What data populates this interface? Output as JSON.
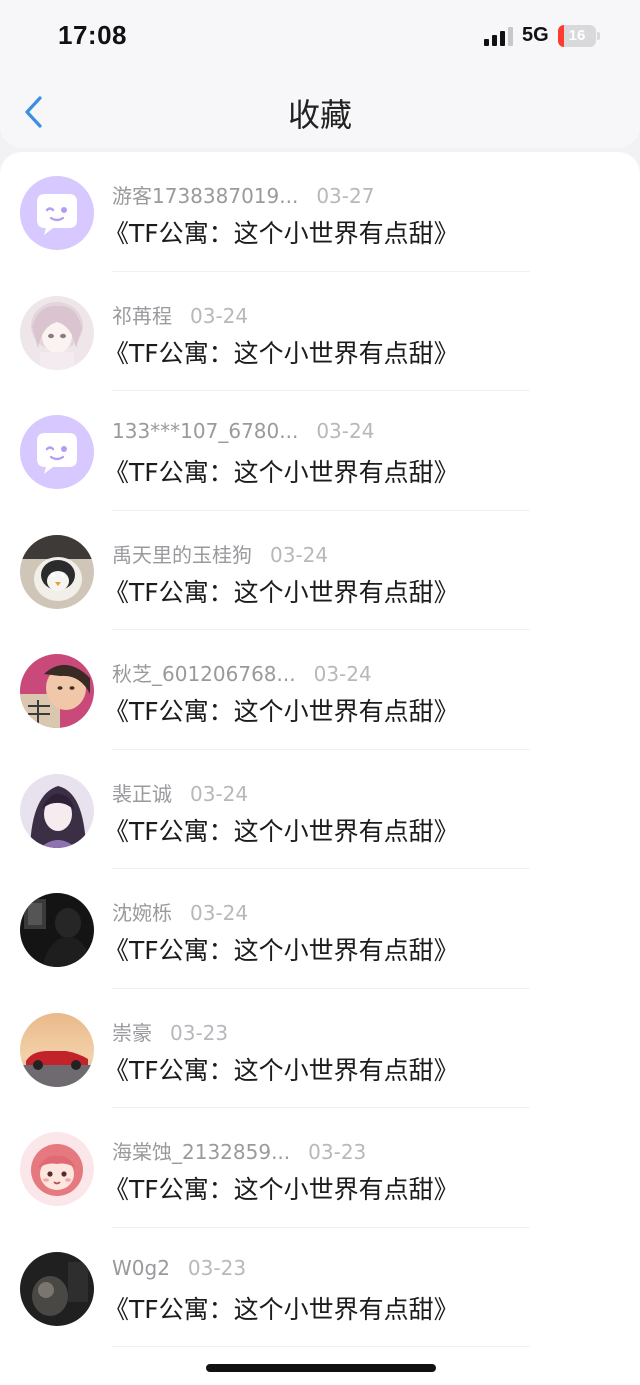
{
  "status_bar": {
    "time": "17:08",
    "network": "5G",
    "battery": {
      "level": "16",
      "fraction": 0.16,
      "color": "#ff3b30"
    }
  },
  "nav": {
    "back_icon": "chevron-left-icon",
    "title": "收藏",
    "accent": "#3a8ee6"
  },
  "favorites": [
    {
      "user": "游客1738387019...",
      "date": "03-27",
      "work": "《TF公寓：这个小世界有点甜》",
      "avatar": "default-chat-avatar"
    },
    {
      "user": "祁苒程",
      "date": "03-24",
      "work": "《TF公寓：这个小世界有点甜》",
      "avatar": "anime-girl-light"
    },
    {
      "user": "133***107_6780...",
      "date": "03-24",
      "work": "《TF公寓：这个小世界有点甜》",
      "avatar": "default-chat-avatar"
    },
    {
      "user": "禹天里的玉桂狗",
      "date": "03-24",
      "work": "《TF公寓：这个小世界有点甜》",
      "avatar": "penguin-plush"
    },
    {
      "user": "秋芝_601206768...",
      "date": "03-24",
      "work": "《TF公寓：这个小世界有点甜》",
      "avatar": "child-photo"
    },
    {
      "user": "裴正诚",
      "date": "03-24",
      "work": "《TF公寓：这个小世界有点甜》",
      "avatar": "anime-character-purple"
    },
    {
      "user": "沈婉栎",
      "date": "03-24",
      "work": "《TF公寓：这个小世界有点甜》",
      "avatar": "dark-silhouette"
    },
    {
      "user": "崇豪",
      "date": "03-23",
      "work": "《TF公寓：这个小世界有点甜》",
      "avatar": "sunset-car"
    },
    {
      "user": "海棠蚀_2132859...",
      "date": "03-23",
      "work": "《TF公寓：这个小世界有点甜》",
      "avatar": "cartoon-girl-pink"
    },
    {
      "user": "W0g2",
      "date": "03-23",
      "work": "《TF公寓：这个小世界有点甜》",
      "avatar": "dark-photo"
    }
  ]
}
